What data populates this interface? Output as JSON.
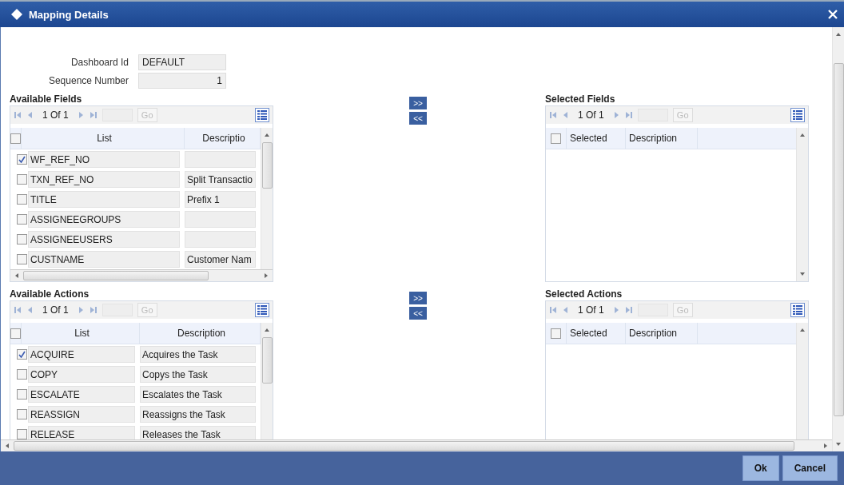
{
  "window": {
    "title": "Mapping Details"
  },
  "form": [
    {
      "kind": "text",
      "label": "Dashboard Id",
      "value": "DEFAULT"
    },
    {
      "kind": "number",
      "label": "Sequence Number",
      "value": "1"
    }
  ],
  "sections": [
    {
      "available": {
        "title": "Available Fields",
        "pager": "1 Of 1",
        "go": "Go",
        "header_checked": false,
        "columns": [
          "List",
          "Descriptio"
        ],
        "rows": [
          {
            "list": "WF_REF_NO",
            "checked": true
          },
          {
            "list": "TXN_REF_NO",
            "description": "Split Transactio",
            "checked": false
          },
          {
            "list": "TITLE",
            "description": "Prefix 1",
            "checked": false
          },
          {
            "list": "ASSIGNEEGROUPS",
            "checked": false
          },
          {
            "list": "ASSIGNEEUSERS",
            "checked": false
          },
          {
            "list": "CUSTNAME",
            "description": "Customer Nam",
            "checked": false
          }
        ]
      },
      "transfer": [
        ">>",
        "<<"
      ],
      "selected": {
        "title": "Selected Fields",
        "pager": "1 Of 1",
        "go": "Go",
        "header_checked": false,
        "columns": [
          "Selected",
          "Description"
        ]
      }
    },
    {
      "available": {
        "title": "Available Actions",
        "pager": "1 Of 1",
        "go": "Go",
        "header_checked": false,
        "columns": [
          "List",
          "Description"
        ],
        "rows": [
          {
            "list": "ACQUIRE",
            "description": "Acquires the Task",
            "checked": true
          },
          {
            "list": "COPY",
            "description": "Copys the Task",
            "checked": false
          },
          {
            "list": "ESCALATE",
            "description": "Escalates the Task",
            "checked": false
          },
          {
            "list": "REASSIGN",
            "description": "Reassigns the Task",
            "checked": false
          },
          {
            "list": "RELEASE",
            "description": "Releases the Task",
            "checked": false
          }
        ]
      },
      "transfer": [
        ">>",
        "<<"
      ],
      "selected": {
        "title": "Selected Actions",
        "pager": "1 Of 1",
        "go": "Go",
        "header_checked": false,
        "columns": [
          "Selected",
          "Description"
        ]
      }
    }
  ],
  "buttons": [
    "Ok",
    "Cancel"
  ]
}
